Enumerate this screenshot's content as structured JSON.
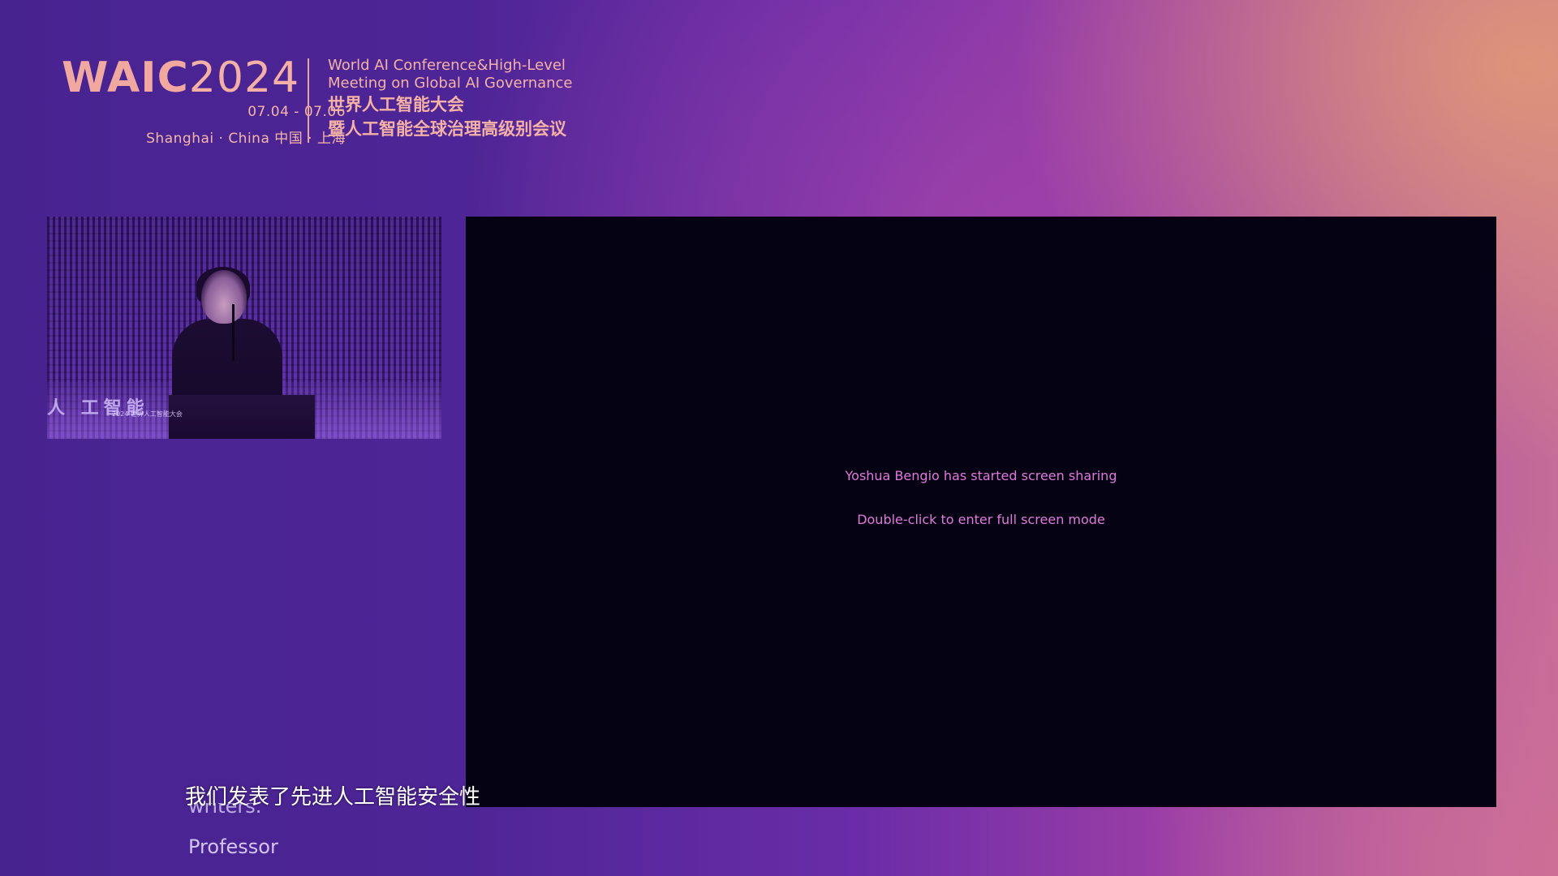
{
  "event": {
    "wordmark": "WAIC",
    "year": "2024",
    "dates": "07.04 - 07.06",
    "location": "Shanghai · China  中国 · 上海",
    "title_en_line1": "World AI Conference&High-Level",
    "title_en_line2": "Meeting on Global AI Governance",
    "title_zh_line1": "世界人工智能大会",
    "title_zh_line2": "暨人工智能全球治理高级别会议",
    "brand_color": "#f0a8a0"
  },
  "speaker_video": {
    "backdrop_text": "人 工智能",
    "caption": "2024 世界人工智能大会"
  },
  "screen_share": {
    "status_message": "Yoshua Bengio has started screen sharing",
    "hint_message": "Double-click to enter full screen mode",
    "message_color": "#e07ad8",
    "background_color": "#050214"
  },
  "subtitles": {
    "current_zh": "我们发表了先进人工智能安全性",
    "behind_line1": "writers.",
    "behind_line2": "Professor"
  }
}
